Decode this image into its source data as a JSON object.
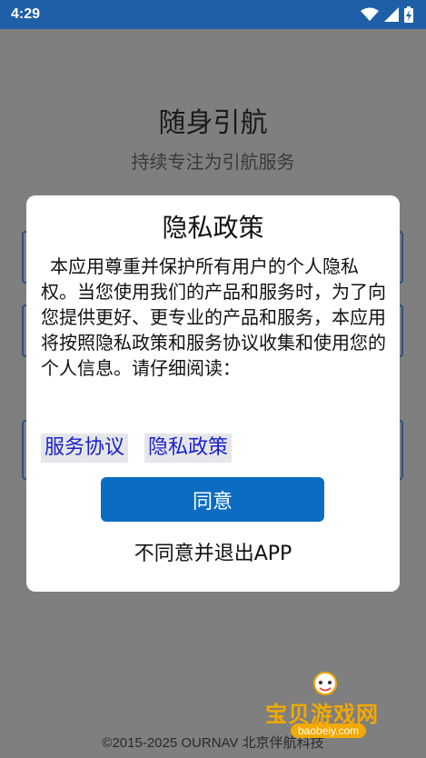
{
  "status_bar": {
    "time": "4:29",
    "icons": [
      "wifi-icon",
      "cellular-signal-icon",
      "battery-charging-icon"
    ]
  },
  "app": {
    "title": "随身引航",
    "subtitle": "持续专注为引航服务",
    "footer": "©2015-2025 OURNAV 北京伴航科技"
  },
  "dialog": {
    "title": "隐私政策",
    "body": "本应用尊重并保护所有用户的个人隐私权。当您使用我们的产品和服务时，为了向您提供更好、更专业的产品和服务，本应用将按照隐私政策和服务协议收集和使用您的个人信息。请仔细阅读：",
    "links": [
      "服务协议",
      "隐私政策"
    ],
    "agree_label": "同意",
    "disagree_label": "不同意并退出APP"
  },
  "watermark": {
    "text": "宝贝游戏网",
    "url": "baobeiy.com"
  },
  "colors": {
    "status_bar": "#1f5fa8",
    "overlay_background": "#7f7f7f",
    "dialog_background": "#ffffff",
    "agree_button": "#0b6cc2",
    "link_text": "#1a22c8",
    "watermark": "#f2a900"
  }
}
